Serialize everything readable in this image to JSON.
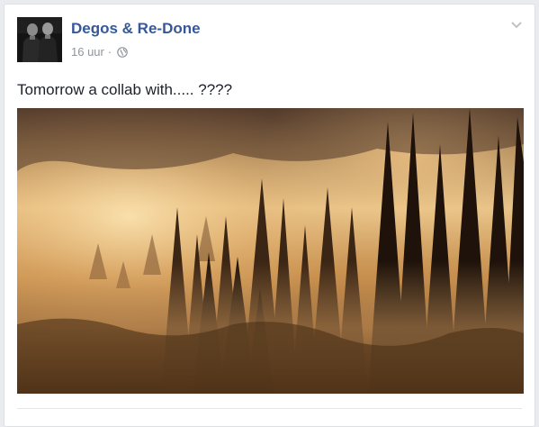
{
  "post": {
    "author": "Degos & Re-Done",
    "timestamp": "16 uur",
    "separator": "·",
    "privacy_icon": "globe-icon",
    "menu_icon": "chevron-down-icon",
    "text": "Tomorrow a collab with..... ????",
    "avatar_icon": "avatar-photo",
    "image_icon": "foggy-forest-photo"
  },
  "colors": {
    "author_link": "#365899",
    "meta_text": "#90949c",
    "body_text": "#1d2129"
  }
}
